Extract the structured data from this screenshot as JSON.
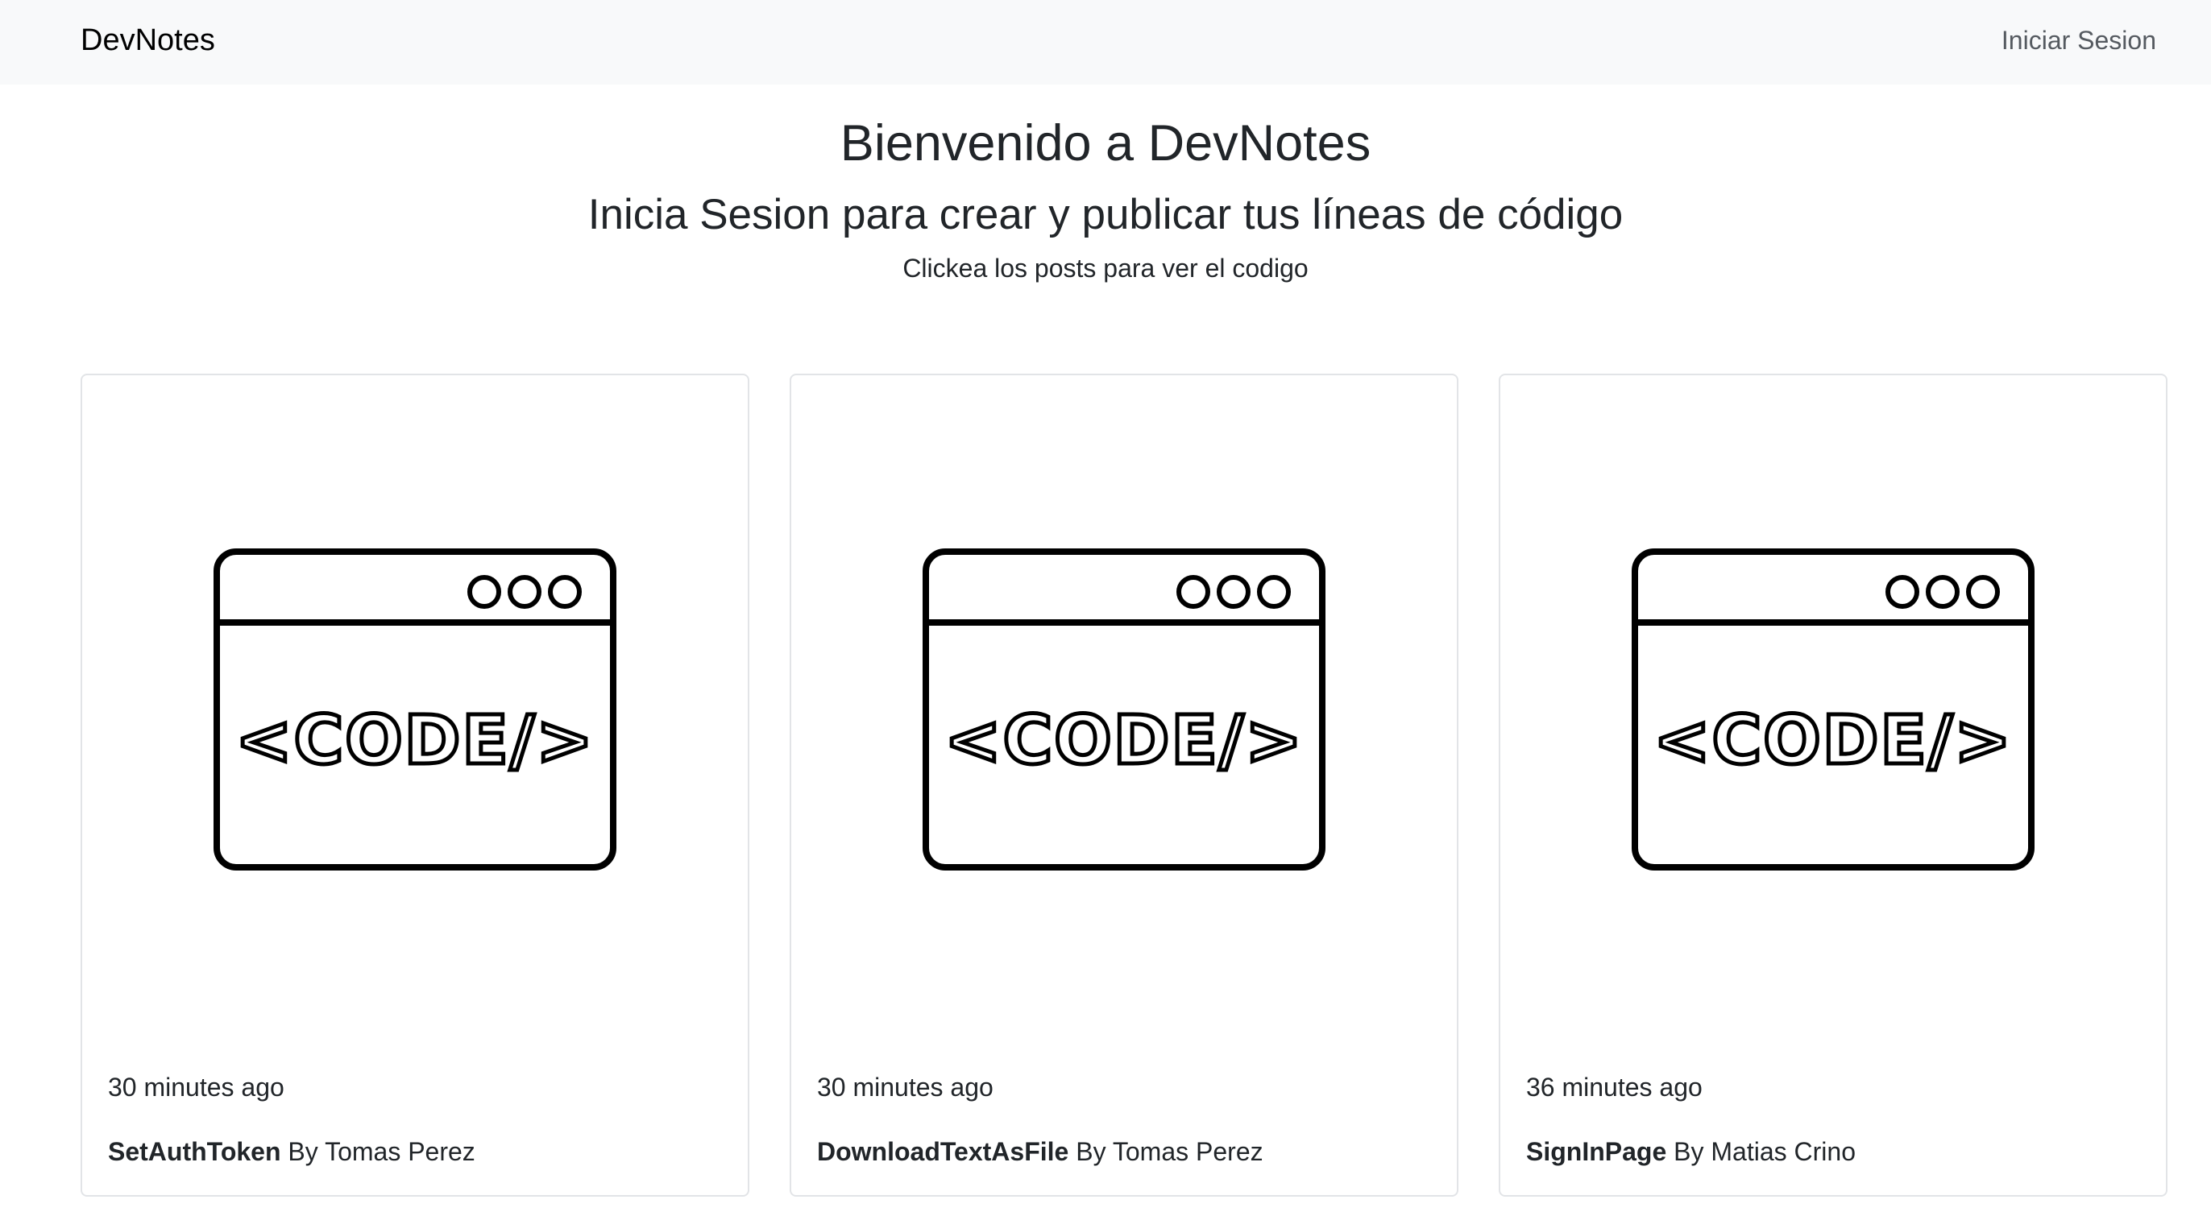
{
  "navbar": {
    "brand": "DevNotes",
    "login_link": "Iniciar Sesion"
  },
  "hero": {
    "title": "Bienvenido a DevNotes",
    "subtitle": "Inicia Sesion para crear y publicar tus líneas de código",
    "hint": "Clickea los posts para ver el codigo"
  },
  "posts": [
    {
      "time": "30 minutes ago",
      "name": "SetAuthToken",
      "author": "By Tomas Perez",
      "icon": "code-window-icon"
    },
    {
      "time": "30 minutes ago",
      "name": "DownloadTextAsFile",
      "author": "By Tomas Perez",
      "icon": "code-window-icon"
    },
    {
      "time": "36 minutes ago",
      "name": "SignInPage",
      "author": "By Matias Crino",
      "icon": "code-window-icon"
    }
  ]
}
